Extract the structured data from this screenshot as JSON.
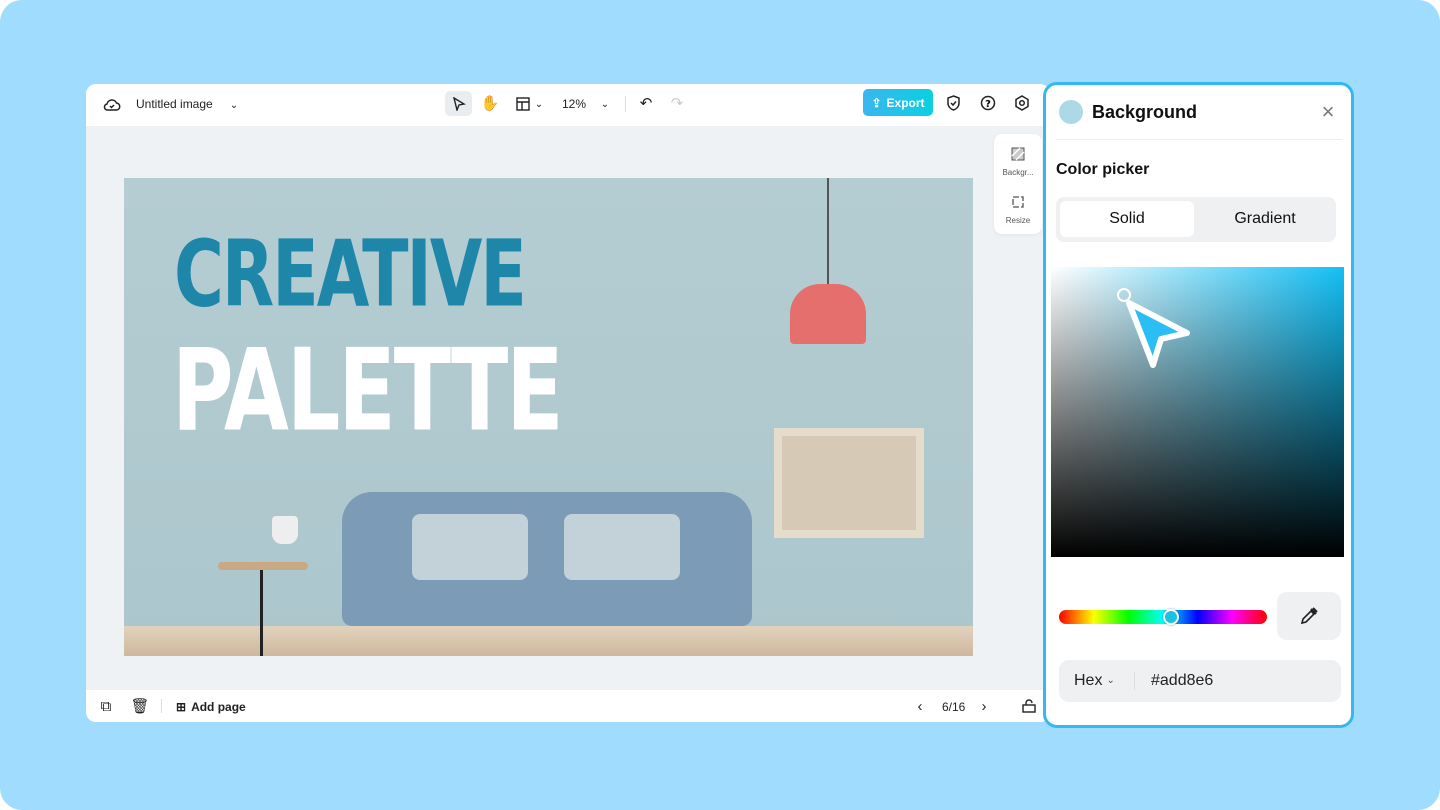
{
  "topbar": {
    "title": "Untitled image",
    "zoom": "12%",
    "export_label": "Export"
  },
  "side_tools": [
    {
      "label": "Backgr...",
      "icon": "background-icon"
    },
    {
      "label": "Resize",
      "icon": "resize-icon"
    }
  ],
  "canvas": {
    "headline_line1": "CREATIVE",
    "headline_line2": "PALETTE"
  },
  "bottombar": {
    "add_page": "Add page",
    "page_indicator": "6/16"
  },
  "panel": {
    "title": "Background",
    "section": "Color picker",
    "tabs": [
      {
        "label": "Solid",
        "active": true
      },
      {
        "label": "Gradient",
        "active": false
      }
    ],
    "format": "Hex",
    "value": "#add8e6",
    "swatch_color": "#add8e6",
    "hue_position": 0.54
  },
  "colors": {
    "accent": "#35b8f0",
    "page_bg": "#a0dcfd",
    "headline": "#1e86a8"
  }
}
